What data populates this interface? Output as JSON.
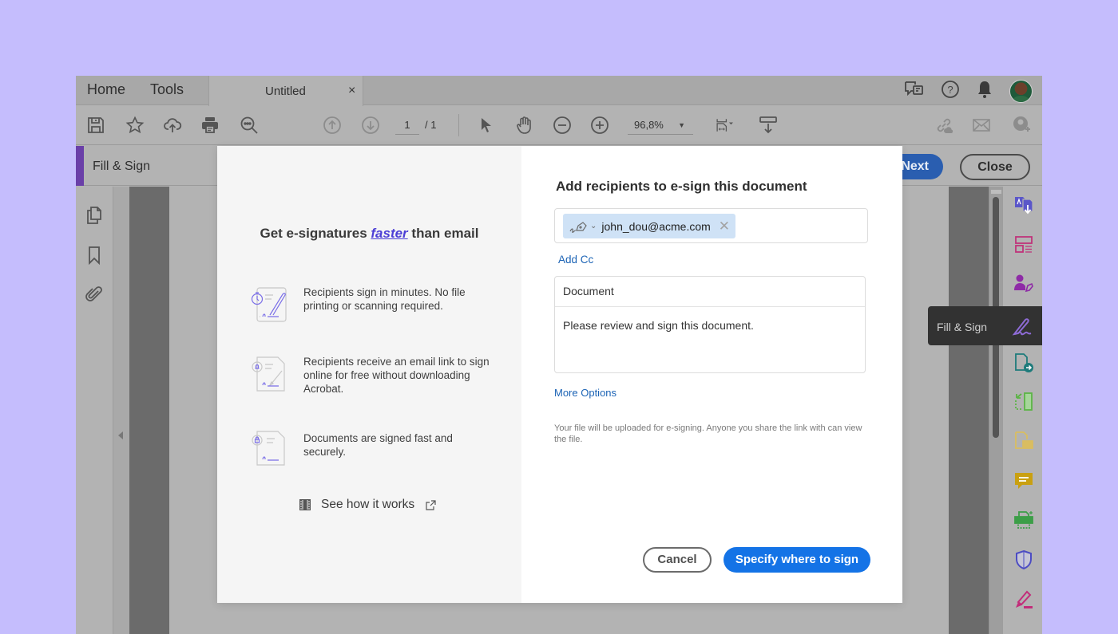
{
  "tabbar": {
    "nav_tabs": [
      "Home",
      "Tools"
    ],
    "document_tab": {
      "title": "Untitled",
      "close_glyph": "×"
    },
    "right_icons": [
      "feedback-icon",
      "help-icon",
      "bell-icon",
      "user-avatar"
    ]
  },
  "toolbar": {
    "left_icons": [
      "save-icon",
      "star-icon",
      "upload-cloud-icon",
      "print-icon",
      "search-zoom-icon"
    ],
    "page_nav_icons": [
      "page-up-icon",
      "page-down-icon"
    ],
    "current_page": "1",
    "total_pages": "/ 1",
    "tools": [
      "select-cursor-icon",
      "hand-icon",
      "zoom-out-icon",
      "zoom-in-icon"
    ],
    "zoom_level": "96,8%",
    "view_icons": [
      "fit-page-icon",
      "scroll-mode-icon"
    ],
    "share_icons": [
      "share-link-icon",
      "email-icon",
      "add-user-icon"
    ]
  },
  "fill_sign_bar": {
    "label": "Fill & Sign",
    "next_label": "Next",
    "close_label": "Close",
    "accent_color": "#6a3fa8"
  },
  "left_rail": [
    "pages-icon",
    "bookmark-icon",
    "attachment-icon"
  ],
  "right_rail": {
    "tools": [
      {
        "name": "export-pdf-icon",
        "color": "#5a56c9"
      },
      {
        "name": "organize-pages-icon",
        "color": "#c0337a"
      },
      {
        "name": "request-signatures-icon",
        "color": "#8e2ba6"
      },
      {
        "name": "fill-sign-icon",
        "color": "#8e6bd6"
      },
      {
        "name": "send-for-review-icon",
        "color": "#1e7b7b"
      },
      {
        "name": "compress-icon",
        "color": "#5bb445"
      },
      {
        "name": "comment-file-icon",
        "color": "#d9bd61"
      },
      {
        "name": "comment-icon",
        "color": "#c9a011"
      },
      {
        "name": "scan-icon",
        "color": "#3c9e48"
      },
      {
        "name": "protect-icon",
        "color": "#4c4cc3"
      },
      {
        "name": "highlight-icon",
        "color": "#c22d7a"
      }
    ],
    "tooltip": "Fill & Sign"
  },
  "modal": {
    "promo": {
      "title_before": "Get e-signatures ",
      "title_emphasis": "faster",
      "title_after": " than email",
      "features": [
        {
          "icon": "stopwatch-sign-icon",
          "text": "Recipients sign in minutes. No file printing or scanning required."
        },
        {
          "icon": "bell-sign-icon",
          "text": "Recipients receive an email link to sign online for free without downloading Acrobat."
        },
        {
          "icon": "lock-sign-icon",
          "text": "Documents are signed fast and securely."
        }
      ],
      "see_how_label": "See how it works"
    },
    "form": {
      "title": "Add recipients to e-sign this document",
      "recipients": [
        {
          "email": "john_dou@acme.com",
          "role_icon": "signer-icon"
        }
      ],
      "add_cc_label": "Add Cc",
      "subject": "Document",
      "message": "Please review and sign this document.",
      "more_options_label": "More Options",
      "notice": "Your file will be uploaded for e-signing. Anyone you share the link with can view the file.",
      "cancel_label": "Cancel",
      "submit_label": "Specify where to sign",
      "primary_color": "#1473e6",
      "link_color": "#1b63b5"
    }
  }
}
